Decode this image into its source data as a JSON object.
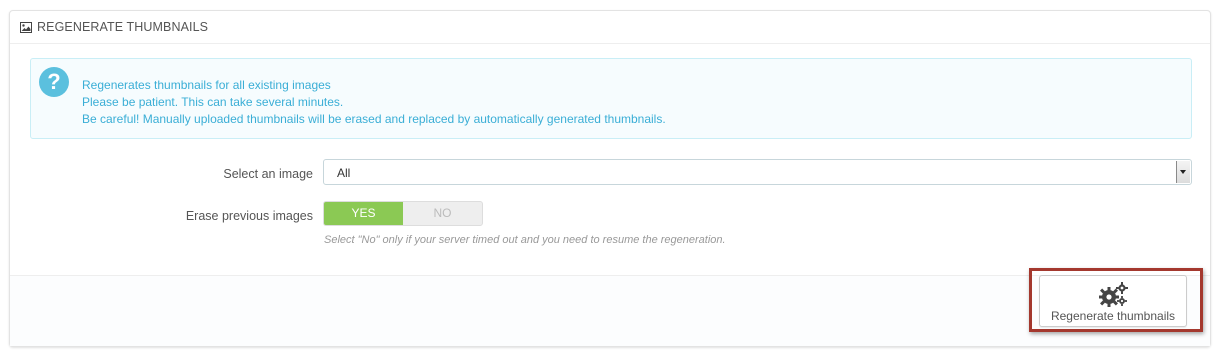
{
  "panel": {
    "title": "REGENERATE THUMBNAILS",
    "title_icon": "picture-icon"
  },
  "alert": {
    "icon": "question-icon",
    "icon_glyph": "?",
    "lines": [
      "Regenerates thumbnails for all existing images",
      "Please be patient. This can take several minutes.",
      "Be careful! Manually uploaded thumbnails will be erased and replaced by automatically generated thumbnails."
    ]
  },
  "form": {
    "select_label": "Select an image",
    "select_value": "All",
    "erase_label": "Erase previous images",
    "erase_yes": "YES",
    "erase_no": "NO",
    "erase_selected": "YES",
    "erase_help": "Select \"No\" only if your server timed out and you need to resume the regeneration."
  },
  "footer": {
    "button_label": "Regenerate thumbnails",
    "button_icon": "cogs-icon",
    "highlight_color": "#a4382e"
  },
  "colors": {
    "toggle_on": "#8bc954",
    "alert_text": "#3aaed6",
    "alert_icon": "#5bc0de"
  }
}
